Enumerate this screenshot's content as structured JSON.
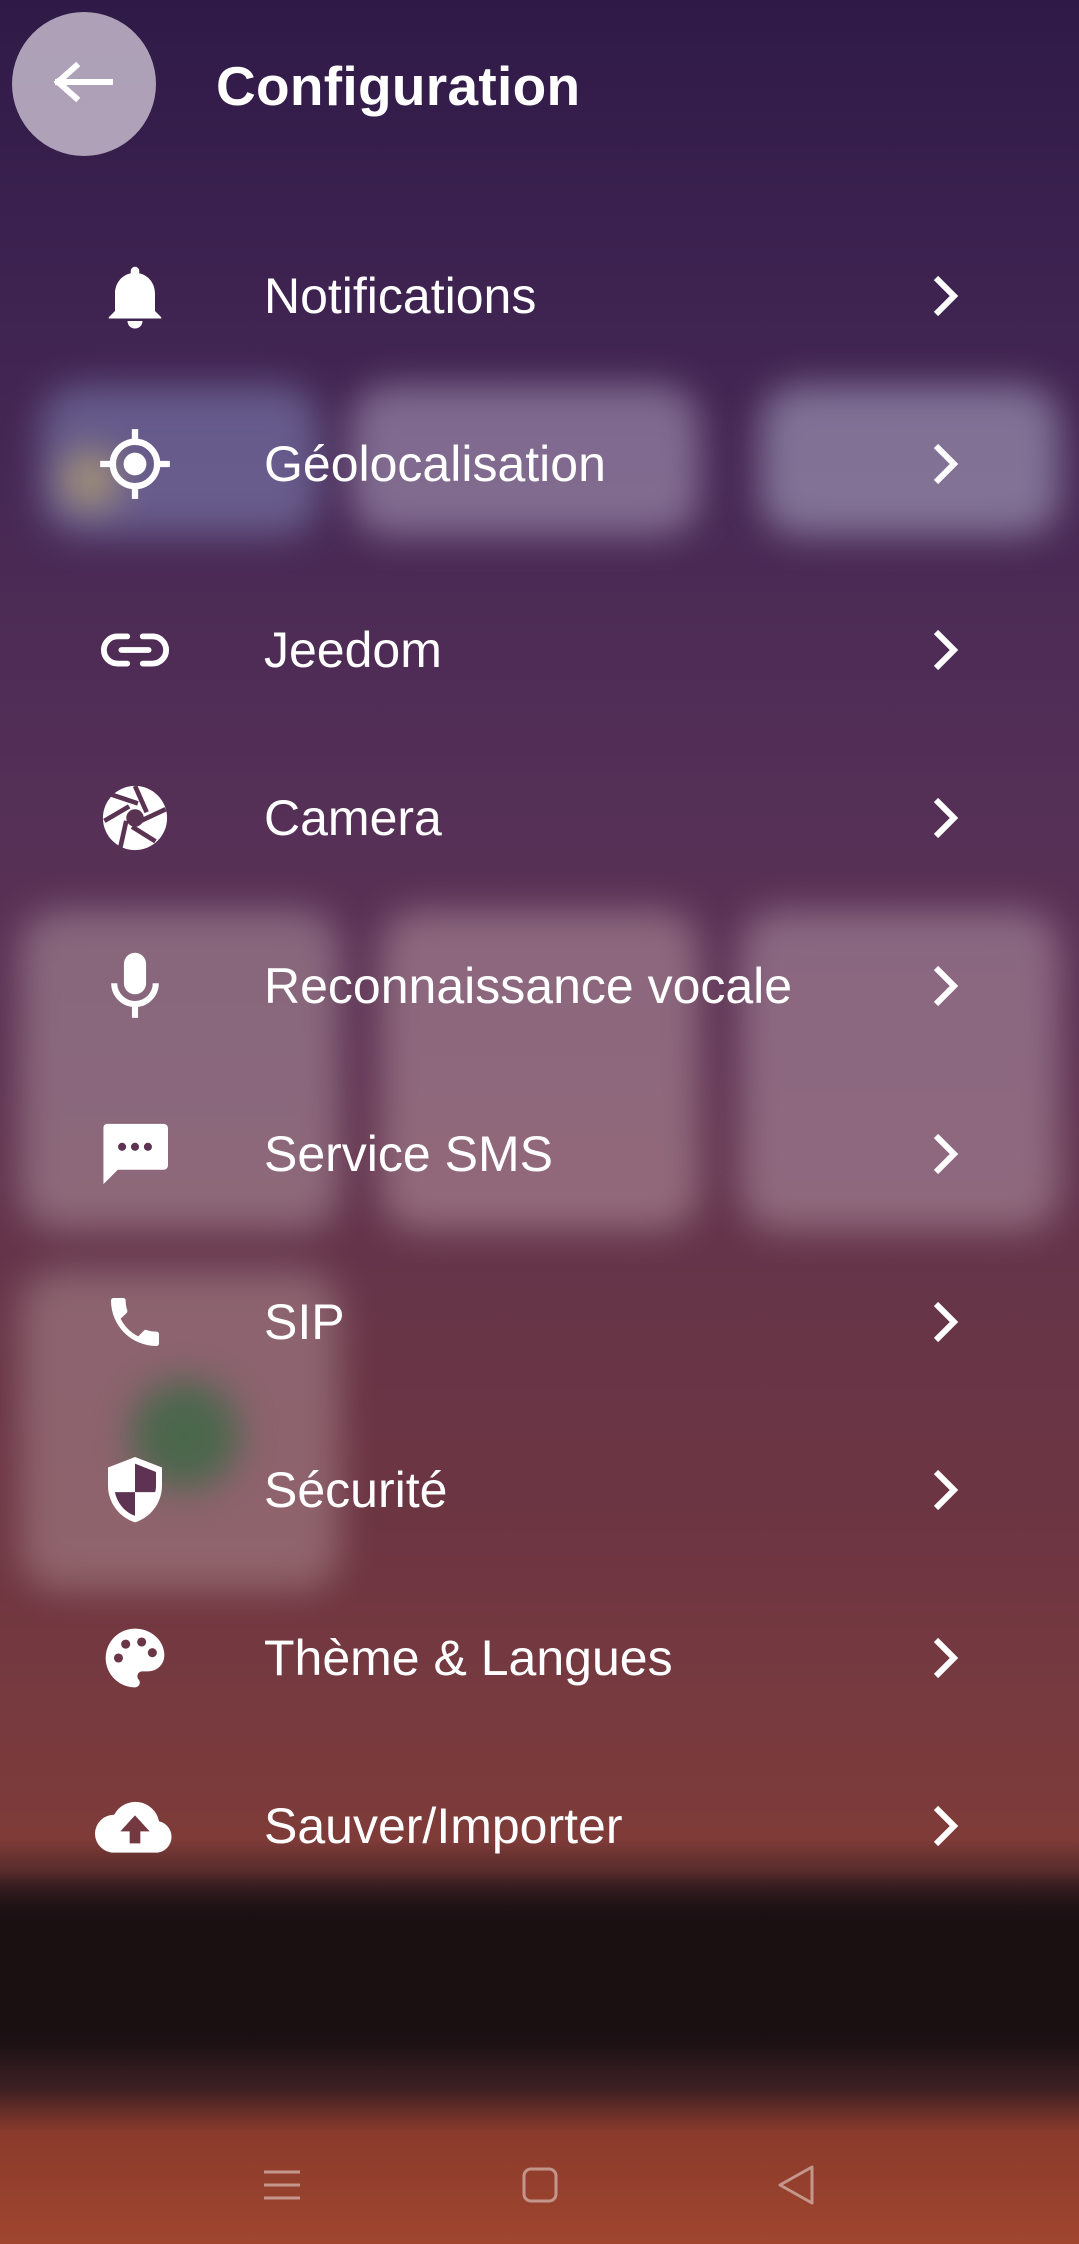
{
  "header": {
    "title": "Configuration",
    "back_icon": "arrow-left-icon"
  },
  "menu": {
    "items": [
      {
        "label": "Notifications",
        "icon": "bell-icon"
      },
      {
        "label": "Géolocalisation",
        "icon": "crosshair-icon"
      },
      {
        "label": "Jeedom",
        "icon": "link-icon"
      },
      {
        "label": "Camera",
        "icon": "camera-shutter-icon"
      },
      {
        "label": "Reconnaissance vocale",
        "icon": "microphone-icon"
      },
      {
        "label": "Service SMS",
        "icon": "sms-icon"
      },
      {
        "label": "SIP",
        "icon": "phone-icon"
      },
      {
        "label": "Sécurité",
        "icon": "shield-icon"
      },
      {
        "label": "Thème & Langues",
        "icon": "palette-icon"
      },
      {
        "label": "Sauver/Importer",
        "icon": "cloud-upload-icon"
      }
    ],
    "chevron_icon": "chevron-right-icon"
  },
  "navbar": {
    "icons": [
      "menu-icon",
      "home-square-icon",
      "back-triangle-icon"
    ]
  },
  "colors": {
    "text": "#ffffff",
    "back_button_bg": "#d7cddc"
  }
}
